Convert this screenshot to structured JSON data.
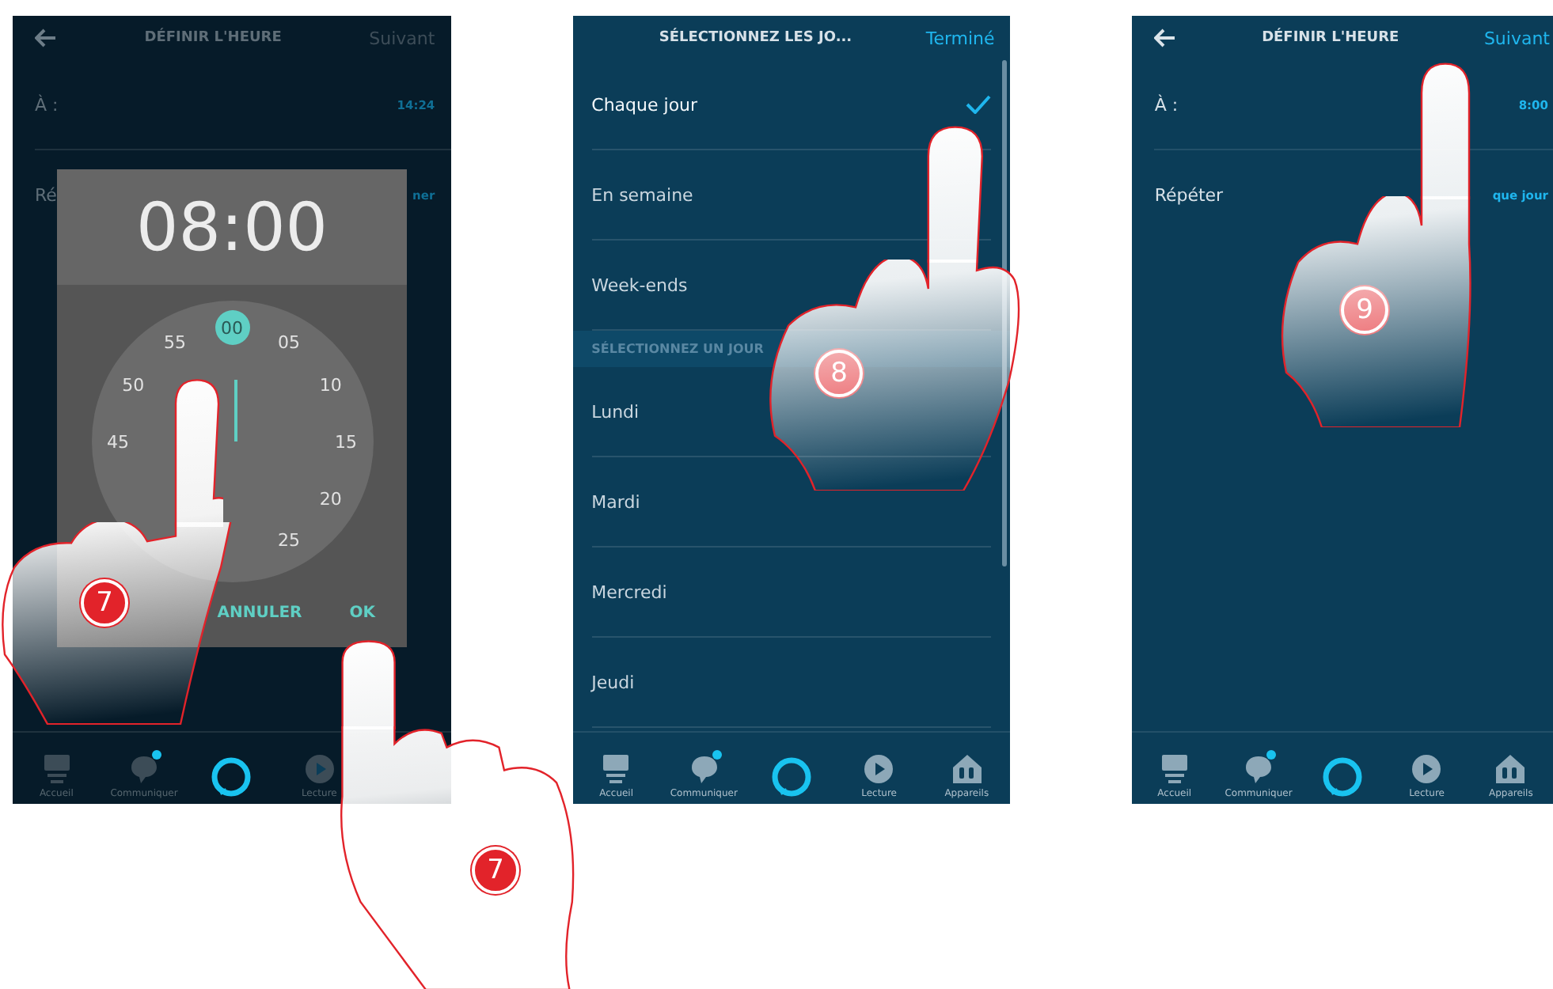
{
  "screens": [
    {
      "kind": "time_dialog",
      "header": {
        "title": "DÉFINIR L'HEURE",
        "action": "Suivant",
        "disabled": true
      },
      "rows": [
        {
          "label": "À :",
          "value": "14:24"
        },
        {
          "label": "Ré",
          "value": "ner"
        }
      ],
      "dialog": {
        "time": "08:00",
        "dial": [
          {
            "label": "00",
            "selected": true
          },
          {
            "label": "05",
            "selected": false
          },
          {
            "label": "10",
            "selected": false
          },
          {
            "label": "15",
            "selected": false
          },
          {
            "label": "20",
            "selected": false
          },
          {
            "label": "25",
            "selected": false
          },
          {
            "label": "45",
            "selected": false
          },
          {
            "label": "50",
            "selected": false
          },
          {
            "label": "55",
            "selected": false
          }
        ],
        "buttons": [
          "ANNULER",
          "OK"
        ]
      },
      "nav": [
        {
          "kind": "home",
          "label": "Accueil",
          "badge": false
        },
        {
          "kind": "chat",
          "label": "Communiquer",
          "badge": true
        },
        {
          "kind": "alexa",
          "badge": false
        },
        {
          "kind": "play",
          "label": "Lecture",
          "badge": false
        }
      ]
    },
    {
      "kind": "day_list",
      "header": {
        "title": "SÉLECTIONNEZ LES JO...",
        "action": "Terminé",
        "disabled": false
      },
      "options": [
        {
          "label": "Chaque jour",
          "selected": true
        },
        {
          "label": "En semaine",
          "selected": false
        },
        {
          "label": "Week-ends",
          "selected": false
        }
      ],
      "section": "SÉLECTIONNEZ UN JOUR",
      "days": [
        {
          "label": "Lundi",
          "selected": false
        },
        {
          "label": "Mardi",
          "selected": false
        },
        {
          "label": "Mercredi",
          "selected": false
        },
        {
          "label": "Jeudi",
          "selected": false
        }
      ],
      "nav": [
        {
          "kind": "home",
          "label": "Accueil",
          "badge": false
        },
        {
          "kind": "chat",
          "label": "Communiquer",
          "badge": true
        },
        {
          "kind": "alexa",
          "badge": false
        },
        {
          "kind": "play",
          "label": "Lecture",
          "badge": false
        },
        {
          "kind": "devices",
          "label": "Appareils",
          "badge": false
        }
      ]
    },
    {
      "kind": "time_form",
      "header": {
        "title": "DÉFINIR L'HEURE",
        "action": "Suivant",
        "disabled": false
      },
      "rows": [
        {
          "label": "À :",
          "value": "8:00"
        },
        {
          "label": "Répéter",
          "value": "que jour"
        }
      ],
      "nav": [
        {
          "kind": "home",
          "label": "Accueil",
          "badge": false
        },
        {
          "kind": "chat",
          "label": "Communiquer",
          "badge": true
        },
        {
          "kind": "alexa",
          "badge": false
        },
        {
          "kind": "play",
          "label": "Lecture",
          "badge": false
        },
        {
          "kind": "devices",
          "label": "Appareils",
          "badge": false
        }
      ]
    }
  ],
  "callouts": [
    {
      "number": "7"
    },
    {
      "number": "8"
    },
    {
      "number": "9"
    },
    {
      "number": "7"
    }
  ]
}
